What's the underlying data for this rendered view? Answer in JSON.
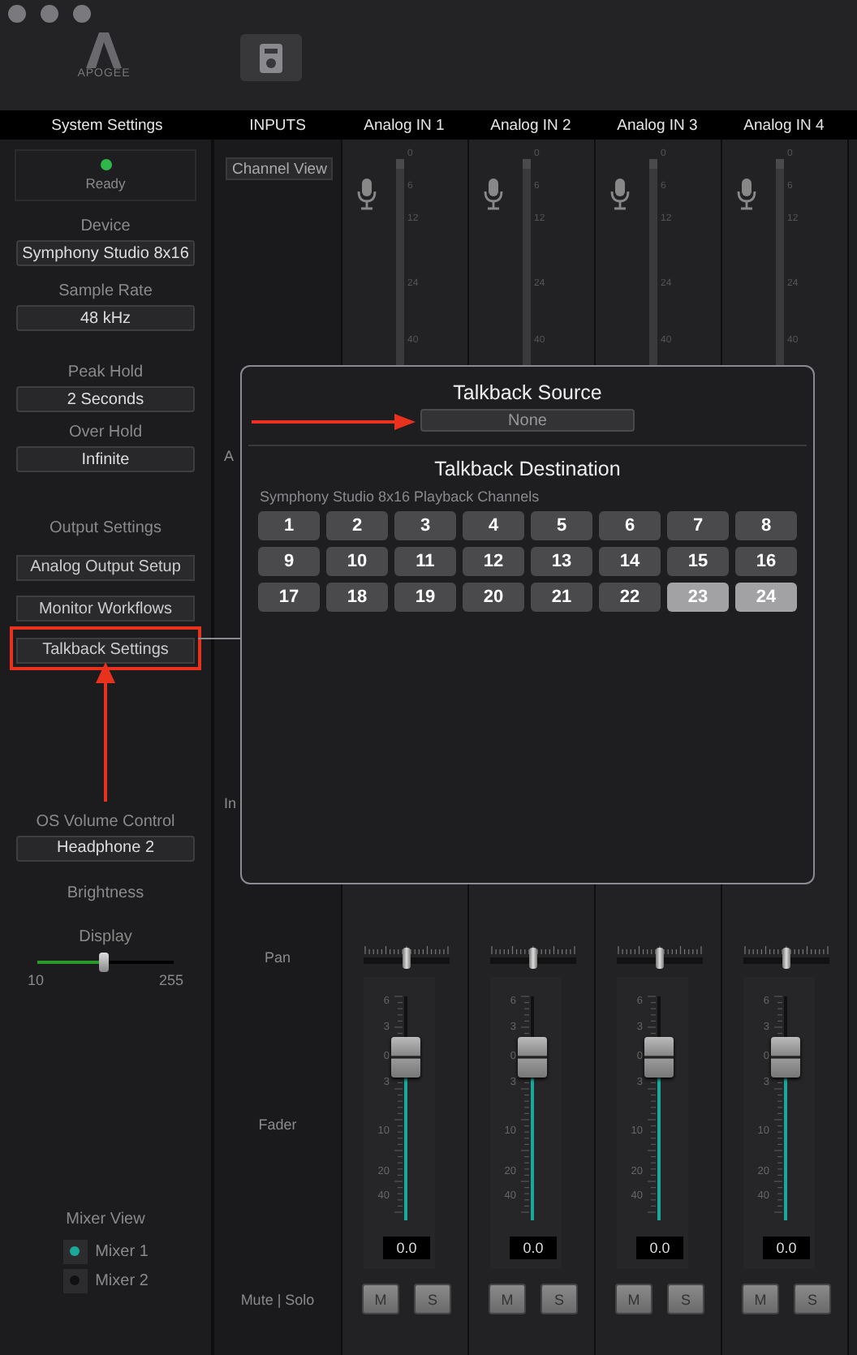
{
  "window": {
    "logo": "APOGEE"
  },
  "header": {
    "settings_title": "System Settings",
    "inputs_title": "INPUTS"
  },
  "sidebar": {
    "status": {
      "label": "Ready",
      "on": true
    },
    "device": {
      "label": "Device",
      "value": "Symphony Studio 8x16"
    },
    "sample_rate": {
      "label": "Sample Rate",
      "value": "48 kHz"
    },
    "peak_hold": {
      "label": "Peak Hold",
      "value": "2 Seconds"
    },
    "over_hold": {
      "label": "Over Hold",
      "value": "Infinite"
    },
    "output_settings": {
      "label": "Output Settings",
      "buttons": [
        {
          "label": "Analog Output Setup",
          "highlighted": false
        },
        {
          "label": "Monitor Workflows",
          "highlighted": false
        },
        {
          "label": "Talkback Settings",
          "highlighted": true
        }
      ]
    },
    "os_volume": {
      "label": "OS Volume Control",
      "value": "Headphone 2"
    },
    "brightness": {
      "label": "Brightness",
      "slider_label": "Display",
      "level": 0.49,
      "min": "10",
      "max": "255"
    },
    "mixer_view": {
      "label": "Mixer View",
      "options": [
        {
          "label": "Mixer 1",
          "selected": true
        },
        {
          "label": "Mixer 2",
          "selected": false
        }
      ]
    }
  },
  "label_column": {
    "channel_view": "Channel View",
    "fragments": [
      "A",
      "In"
    ],
    "pan": "Pan",
    "fader": "Fader",
    "mute_solo": "Mute | Solo"
  },
  "channels": [
    {
      "name": "Analog IN 1",
      "meter_ticks": [
        "0",
        "6",
        "12",
        "24",
        "40"
      ],
      "pan": {
        "level": 0.5
      },
      "fader": {
        "level": 0.73,
        "ticks": [
          "6",
          "3",
          "0",
          "3",
          "10",
          "20",
          "40"
        ],
        "value": "0.0"
      },
      "mute": "M",
      "solo": "S"
    },
    {
      "name": "Analog IN 2",
      "meter_ticks": [
        "0",
        "6",
        "12",
        "24",
        "40"
      ],
      "pan": {
        "level": 0.5
      },
      "fader": {
        "level": 0.73,
        "ticks": [
          "6",
          "3",
          "0",
          "3",
          "10",
          "20",
          "40"
        ],
        "value": "0.0"
      },
      "mute": "M",
      "solo": "S"
    },
    {
      "name": "Analog IN 3",
      "meter_ticks": [
        "0",
        "6",
        "12",
        "24",
        "40"
      ],
      "pan": {
        "level": 0.5
      },
      "fader": {
        "level": 0.73,
        "ticks": [
          "6",
          "3",
          "0",
          "3",
          "10",
          "20",
          "40"
        ],
        "value": "0.0"
      },
      "mute": "M",
      "solo": "S"
    },
    {
      "name": "Analog IN 4",
      "meter_ticks": [
        "0",
        "6",
        "12",
        "24",
        "40"
      ],
      "pan": {
        "level": 0.5
      },
      "fader": {
        "level": 0.73,
        "ticks": [
          "6",
          "3",
          "0",
          "3",
          "10",
          "20",
          "40"
        ],
        "value": "0.0"
      },
      "mute": "M",
      "solo": "S"
    }
  ],
  "dialog": {
    "source_title": "Talkback Source",
    "source_value": "None",
    "source_highlighted": true,
    "destination_title": "Talkback Destination",
    "destination_subtitle": "Symphony Studio 8x16 Playback Channels",
    "channels": [
      {
        "label": "1",
        "selected": false
      },
      {
        "label": "2",
        "selected": false
      },
      {
        "label": "3",
        "selected": false
      },
      {
        "label": "4",
        "selected": false
      },
      {
        "label": "5",
        "selected": false
      },
      {
        "label": "6",
        "selected": false
      },
      {
        "label": "7",
        "selected": false
      },
      {
        "label": "8",
        "selected": false
      },
      {
        "label": "9",
        "selected": false
      },
      {
        "label": "10",
        "selected": false
      },
      {
        "label": "11",
        "selected": false
      },
      {
        "label": "12",
        "selected": false
      },
      {
        "label": "13",
        "selected": false
      },
      {
        "label": "14",
        "selected": false
      },
      {
        "label": "15",
        "selected": false
      },
      {
        "label": "16",
        "selected": false
      },
      {
        "label": "17",
        "selected": false
      },
      {
        "label": "18",
        "selected": false
      },
      {
        "label": "19",
        "selected": false
      },
      {
        "label": "20",
        "selected": false
      },
      {
        "label": "21",
        "selected": false
      },
      {
        "label": "22",
        "selected": false
      },
      {
        "label": "23",
        "selected": true
      },
      {
        "label": "24",
        "selected": true
      }
    ]
  }
}
